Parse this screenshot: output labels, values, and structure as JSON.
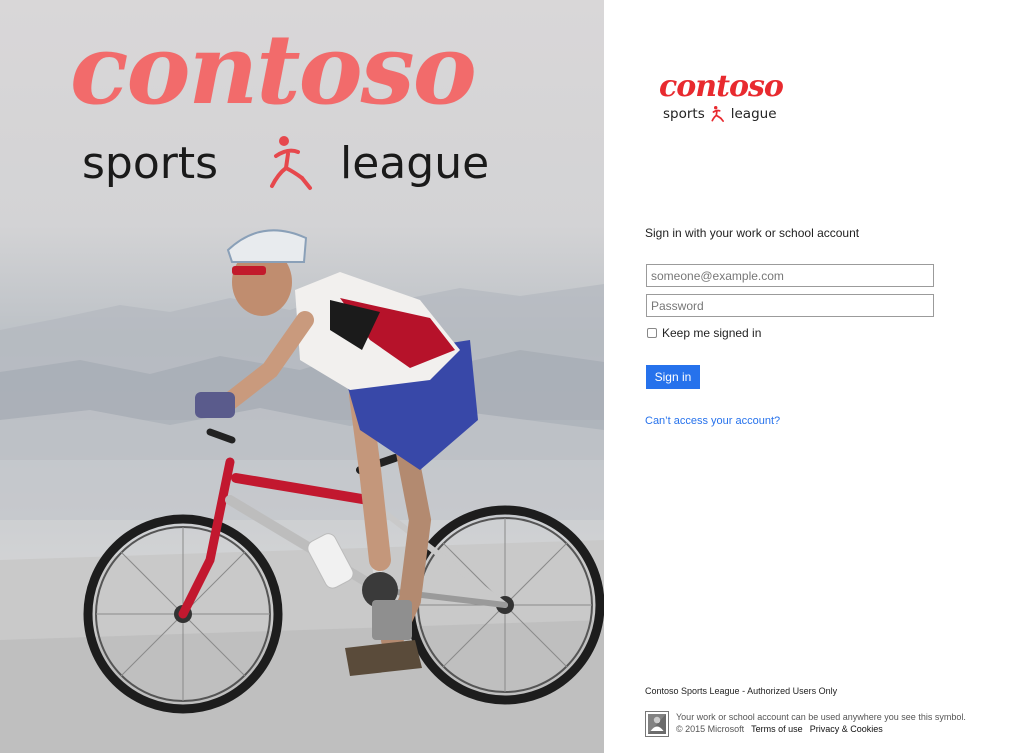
{
  "hero": {
    "wordmark": "contoso",
    "tagline_left": "sports",
    "tagline_right": "league",
    "image": "cyclist-on-mountain-bike"
  },
  "brand": {
    "wordmark": "contoso",
    "tagline_left": "sports",
    "tagline_right": "league",
    "accent_color": "#e82a2f"
  },
  "form": {
    "heading": "Sign in with your work or school account",
    "email_placeholder": "someone@example.com",
    "password_placeholder": "Password",
    "keep_signed_in_label": "Keep me signed in",
    "keep_signed_in_checked": false,
    "signin_label": "Sign in",
    "signin_color": "#2672ec",
    "cant_access_label": "Can’t access your account?"
  },
  "footer": {
    "authorized_text": "Contoso Sports League - Authorized Users Only",
    "symbol_note": "Your work or school account can be used anywhere you see this symbol.",
    "copyright": "© 2015 Microsoft",
    "terms_label": "Terms of use",
    "privacy_label": "Privacy & Cookies",
    "badge_icon": "work-account-badge-icon"
  }
}
